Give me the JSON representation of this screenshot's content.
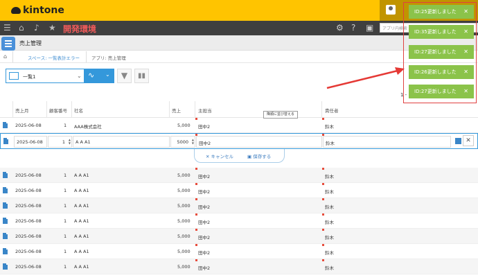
{
  "header": {
    "logo_text": "kintone",
    "dev_label": "開発環境",
    "search_placeholder": "アプリ内検索"
  },
  "appbar": {
    "title": "売上管理"
  },
  "breadcrumb": {
    "space": "スペース: 一覧表計エラー",
    "app": "アプリ: 売上管理"
  },
  "toolbar": {
    "view_name": "一覧1",
    "pager": "1 -"
  },
  "table": {
    "columns": [
      "売上月",
      "顧客番号",
      "社名",
      "売上",
      "主担当",
      "責任者"
    ],
    "tooltip": "降順に並び替える",
    "rows": [
      {
        "month": "2025-06-08",
        "cust": "1",
        "company": "AAA株式会社",
        "sales": "5,000",
        "rep": "田中2",
        "mgr": "鈴木"
      },
      {
        "month": "2025-06-08",
        "cust": "1",
        "company": "A A A1",
        "sales": "5,000",
        "rep": "田中2",
        "mgr": "鈴木"
      },
      {
        "month": "2025-06-08",
        "cust": "1",
        "company": "A A A1",
        "sales": "5,000",
        "rep": "田中2",
        "mgr": "鈴木"
      },
      {
        "month": "2025-06-08",
        "cust": "1",
        "company": "A A A1",
        "sales": "5,000",
        "rep": "田中2",
        "mgr": "鈴木"
      },
      {
        "month": "2025-06-08",
        "cust": "1",
        "company": "A A A1",
        "sales": "5,000",
        "rep": "田中2",
        "mgr": "鈴木"
      },
      {
        "month": "2025-06-08",
        "cust": "1",
        "company": "A A A1",
        "sales": "5,000",
        "rep": "田中2",
        "mgr": "鈴木"
      },
      {
        "month": "2025-06-08",
        "cust": "1",
        "company": "A A A1",
        "sales": "5,000",
        "rep": "田中2",
        "mgr": "鈴木"
      },
      {
        "month": "2025-06-08",
        "cust": "1",
        "company": "A A A1",
        "sales": "5,000",
        "rep": "田中2",
        "mgr": "鈴木"
      }
    ],
    "edit_row": {
      "month": "2025-06-08",
      "cust": "1",
      "company": "A A A1",
      "sales": "5000",
      "rep": "田中2",
      "mgr": "鈴木"
    },
    "cancel_label": "キャンセル",
    "save_label": "保存する"
  },
  "notifications": [
    "ID:25更新しました",
    "ID:35更新しました",
    "ID:27更新しました",
    "ID:26更新しました",
    "ID:27更新しました"
  ],
  "colors": {
    "header": "#ffc400",
    "accent": "#3498db",
    "notification": "#8bc34a",
    "highlight": "#e04040"
  }
}
